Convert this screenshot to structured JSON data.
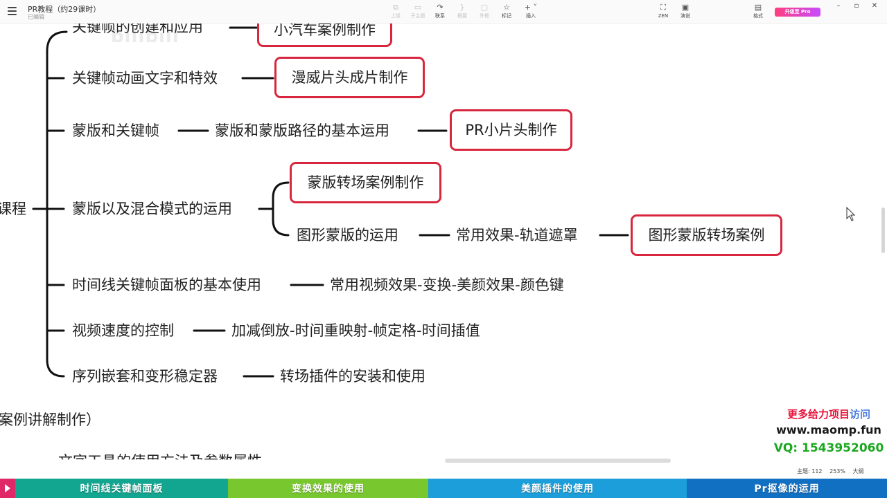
{
  "app": {
    "title": "PR教程（约29课时）",
    "status": "已编辑"
  },
  "toolbar": {
    "items": [
      {
        "label": "上级",
        "icon": "parent-node-icon",
        "enabled": false
      },
      {
        "label": "子主题",
        "icon": "child-node-icon",
        "enabled": false
      },
      {
        "label": "联系",
        "icon": "relationship-icon",
        "enabled": true
      },
      {
        "label": "概要",
        "icon": "summary-icon",
        "enabled": false
      },
      {
        "label": "外框",
        "icon": "boundary-icon",
        "enabled": false
      },
      {
        "label": "标记",
        "icon": "marker-icon",
        "enabled": true
      },
      {
        "label": "插入",
        "icon": "insert-icon",
        "enabled": true
      }
    ],
    "right_items": [
      {
        "label": "ZEN",
        "icon": "zen-icon"
      },
      {
        "label": "演说",
        "icon": "pitch-icon"
      },
      {
        "label": "格式",
        "icon": "format-icon"
      }
    ],
    "upgrade_label": "升级至 Pro"
  },
  "mindmap": {
    "root_partial": "课程",
    "branches": [
      {
        "text": "关键帧的创建和应用",
        "children": [
          {
            "text": "小汽车案例制作",
            "highlight": true
          }
        ]
      },
      {
        "text": "关键帧动画文字和特效",
        "children": [
          {
            "text": "漫威片头成片制作",
            "highlight": true
          }
        ]
      },
      {
        "text": "蒙版和关键帧",
        "children": [
          {
            "text": "蒙版和蒙版路径的基本运用"
          },
          {
            "text": "PR小片头制作",
            "highlight": true
          }
        ]
      },
      {
        "text": "蒙版以及混合模式的运用",
        "children": [
          {
            "text": "蒙版转场案例制作",
            "highlight": true
          },
          {
            "text": "图形蒙版的运用",
            "children": [
              {
                "text": "常用效果-轨道遮罩"
              },
              {
                "text": "图形蒙版转场案例",
                "highlight": true
              }
            ]
          }
        ]
      },
      {
        "text": "时间线关键帧面板的基本使用",
        "children": [
          {
            "text": "常用视频效果-变换-美颜效果-颜色键"
          }
        ]
      },
      {
        "text": "视频速度的控制",
        "children": [
          {
            "text": "加减倒放-时间重映射-帧定格-时间插值"
          }
        ]
      },
      {
        "text": "序列嵌套和变形稳定器",
        "children": [
          {
            "text": "转场插件的安装和使用"
          }
        ]
      }
    ],
    "partial_bottom_1": "案例讲解制作）",
    "partial_bottom_2": "文字工具的使用方法及参数属性"
  },
  "watermark": "bilibili",
  "statusbar": {
    "topic_count": "主题: 112",
    "zoom": "253%",
    "size_label": "大纲"
  },
  "overlay_ad": {
    "line1_a": "更多给力项目",
    "line1_b": "访问",
    "line2": "www.maomp.fun",
    "line3": "VQ:  1543952060"
  },
  "chapters": [
    {
      "label": "时间线关键帧面板",
      "color": "#12a58f"
    },
    {
      "label": "变换效果的使用",
      "color": "#79c72e"
    },
    {
      "label": "美颜插件的使用",
      "color": "#1b9ed9"
    },
    {
      "label": "Pr抠像的运用",
      "color": "#1270c2"
    }
  ],
  "colors": {
    "highlight_border": "#d7263d",
    "line": "#111111"
  }
}
